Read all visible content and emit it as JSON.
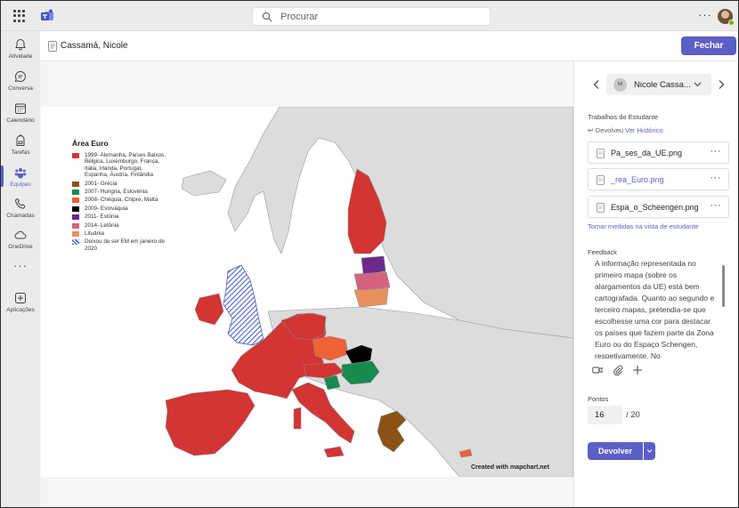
{
  "topbar": {
    "search_placeholder": "Procurar",
    "more_label": "···"
  },
  "rail": {
    "items": [
      {
        "label": "Atividade",
        "icon": "bell-icon"
      },
      {
        "label": "Conversa",
        "icon": "chat-icon"
      },
      {
        "label": "Calendário",
        "icon": "calendar-icon"
      },
      {
        "label": "Tarefas",
        "icon": "backpack-icon"
      },
      {
        "label": "Equipas",
        "icon": "teams-icon"
      },
      {
        "label": "Chamadas",
        "icon": "phone-icon"
      },
      {
        "label": "OneDrive",
        "icon": "cloud-icon"
      },
      {
        "label": "Aplicações",
        "icon": "apps-icon"
      }
    ],
    "active": "Equipas",
    "more_label": "···"
  },
  "header": {
    "student_name": "Cassamá, Nicole",
    "close_label": "Fechar"
  },
  "map": {
    "legend_title": "Área Euro",
    "legend": [
      {
        "text": "1999- Alemanha, Países Baixos, Bélgica, Luxemburgo, França, Itália, Irlanda, Portugal, Espanha, Áustria, Finlândia",
        "color": "#d33434"
      },
      {
        "text": "2001- Grécia",
        "color": "#8a5214"
      },
      {
        "text": "2007- Hungria, Eslovénia",
        "color": "#178a4e"
      },
      {
        "text": "2008- Chéquia, Chipre, Malta",
        "color": "#f06134"
      },
      {
        "text": "2009- Eslováquia",
        "color": "#000000"
      },
      {
        "text": "2011- Estónia",
        "color": "#6b2a8c"
      },
      {
        "text": "2014- Letónia",
        "color": "#d4617e"
      },
      {
        "text": "Lituânia",
        "color": "#e8915c"
      },
      {
        "text": "Deixou de ser EM em janeiro de 2020",
        "color": "#4a63c9"
      }
    ],
    "credit": "Created with mapchart.net"
  },
  "panel": {
    "student_short": "Nicole Cassa...",
    "student_initials": "NI",
    "works_label": "Trabalhos do Estudante",
    "returned_label": "Devolveu",
    "history_link": "Ver Histórico",
    "files": [
      {
        "name": "Pa_ses_da_UE.png"
      },
      {
        "name": "_rea_Euro.png"
      },
      {
        "name": "Espa_o_Scheengen.png"
      }
    ],
    "file_more": "···",
    "actions_link": "Tomar medidas na vista de estudante",
    "feedback_label": "Feedback",
    "feedback_text": "A informação representada no primeiro mapa (sobre os alargamentos da UE) está bem cartografada. Quanto ao segundo e terceiro mapas, pretendia-se que escolhesse uma cor para destacar os países que fazem parte da Zona Euro ou do Espaço Schengen, respetivamente. No",
    "points_label": "Pontos",
    "points_value": "16",
    "points_max": "/ 20",
    "return_label": "Devolver"
  },
  "colors": {
    "accent": "#5b5fc7",
    "map_sea": "#ffffff",
    "map_land": "#dcdcdc"
  }
}
